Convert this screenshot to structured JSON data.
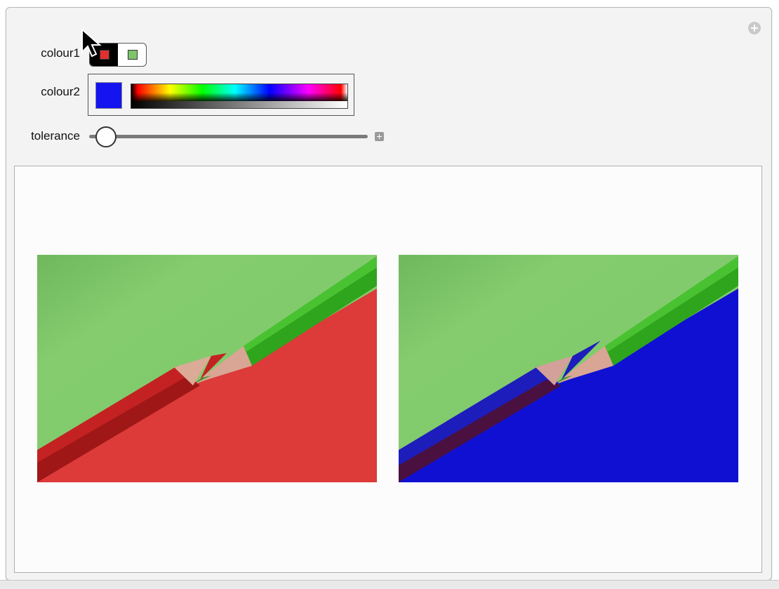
{
  "controls": {
    "colour1": {
      "label": "colour1",
      "options": [
        {
          "name": "red",
          "color": "#e03030",
          "selected": true
        },
        {
          "name": "green",
          "color": "#7ec46a",
          "selected": false
        }
      ]
    },
    "colour2": {
      "label": "colour2",
      "value": "#1414f0"
    },
    "tolerance": {
      "label": "tolerance",
      "value": 0.05
    }
  },
  "output": {
    "original_image": {
      "icon": "red-green-pencils-photo",
      "background": "#7ec96a",
      "region_color": "#dd3a3a",
      "pencil_color": "#c42222"
    },
    "recolored_image": {
      "icon": "blue-green-pencils-photo",
      "background": "#7ec96a",
      "region_color": "#1010d2",
      "pencil_color": "#1d1dbb"
    }
  }
}
